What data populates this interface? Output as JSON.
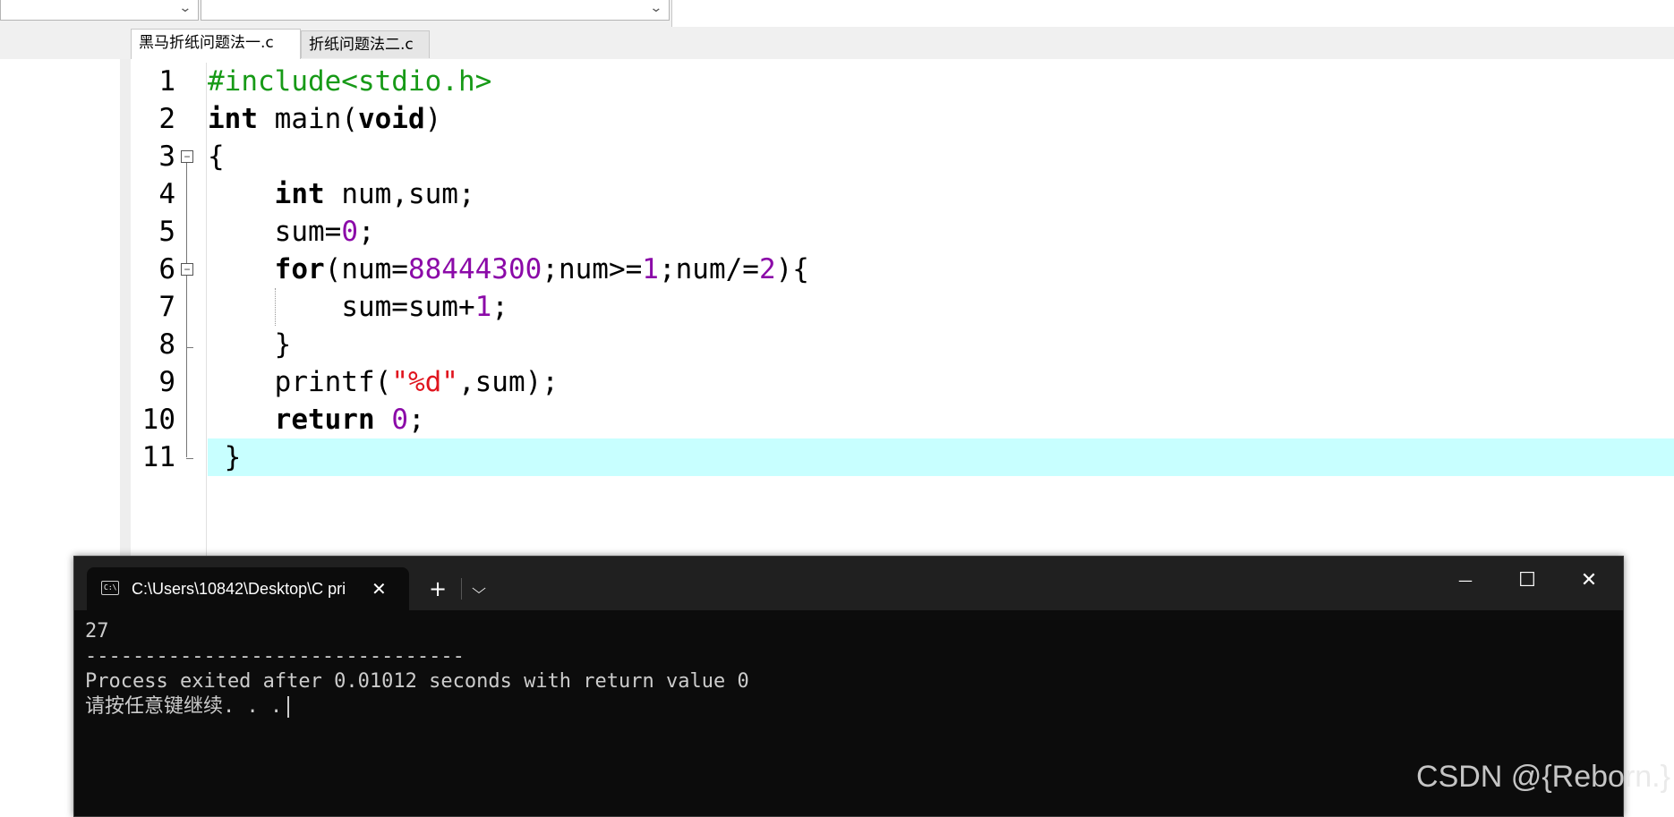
{
  "editor": {
    "tabs": [
      {
        "label": "黑马折纸问题法一.c",
        "active": true
      },
      {
        "label": "折纸问题法二.c",
        "active": false
      }
    ],
    "line_numbers": [
      "1",
      "2",
      "3",
      "4",
      "5",
      "6",
      "7",
      "8",
      "9",
      "10",
      "11"
    ],
    "highlight_color": "#c8ffff",
    "syntax_colors": {
      "number": "#8b0aa8",
      "string": "#e0141e",
      "preprocessor": "#179a17"
    },
    "code": {
      "l1": "#include<stdio.h>",
      "l2_kw": "int",
      "l2_rest": " main(",
      "l2_void": "void",
      "l2_end": ")",
      "l3": "{",
      "l4_kw": "int",
      "l4_rest": " num,sum;",
      "l5_a": "sum=",
      "l5_num": "0",
      "l5_b": ";",
      "l6_kw": "for",
      "l6_a": "(num=",
      "l6_n1": "88444300",
      "l6_b": ";num>=",
      "l6_n2": "1",
      "l6_c": ";num/=",
      "l6_n3": "2",
      "l6_d": "){",
      "l7_a": "sum=sum+",
      "l7_num": "1",
      "l7_b": ";",
      "l8": "}",
      "l9_a": "printf(",
      "l9_str": "\"%d\"",
      "l9_b": ",sum);",
      "l10_kw": "return",
      "l10_num": "0",
      "l10_b": ";",
      "l11": "}"
    }
  },
  "console": {
    "title": "C:\\Users\\10842\\Desktop\\C pri",
    "icon": "cmd-icon",
    "output": {
      "line1": "27",
      "line2": "--------------------------------",
      "line3": "Process exited after 0.01012 seconds with return value 0",
      "line4": "请按任意键继续. . ."
    },
    "controls": {
      "new_tab": "+",
      "dropdown": "⌵",
      "minimize": "—",
      "maximize": "☐",
      "close": "✕",
      "tab_close": "✕"
    }
  },
  "watermark": "CSDN @{Reborn.}"
}
